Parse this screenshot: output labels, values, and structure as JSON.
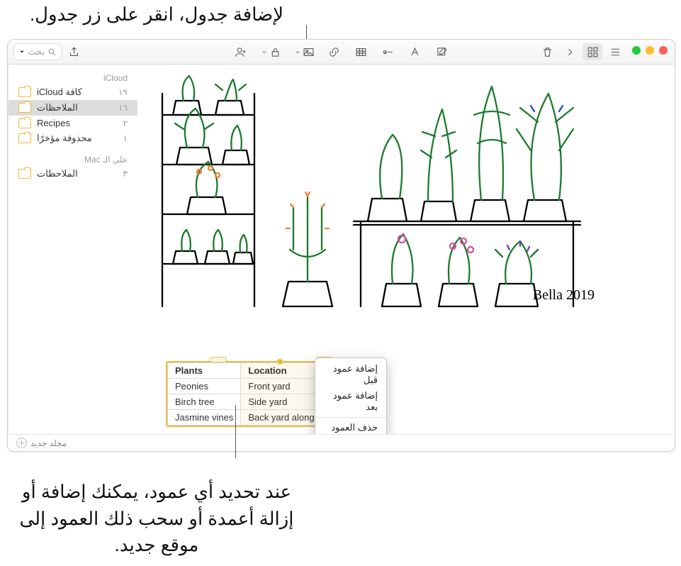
{
  "callouts": {
    "top": "لإضافة جدول، انقر على زر جدول.",
    "bottom": "عند تحديد أي عمود، يمكنك إضافة أو إزالة أعمدة أو سحب ذلك العمود إلى موقع جديد."
  },
  "toolbar": {
    "search_placeholder": "بحث"
  },
  "sidebar": {
    "section1_title": "iCloud",
    "section2_title": "على الـ Mac",
    "items1": [
      {
        "label": "كافة iCloud",
        "count": "١٩"
      },
      {
        "label": "الملاحظات",
        "count": "١٦",
        "selected": true
      },
      {
        "label": "Recipes",
        "count": "٢"
      },
      {
        "label": "محذوفة مؤخرًا",
        "count": "١"
      }
    ],
    "items2": [
      {
        "label": "الملاحظات",
        "count": "٣"
      }
    ]
  },
  "table": {
    "headers": [
      "Plants",
      "Location"
    ],
    "rows": [
      [
        "Peonies",
        "Front yard"
      ],
      [
        "Birch tree",
        "Side yard"
      ],
      [
        "Jasmine vines",
        "Back yard along fence"
      ]
    ]
  },
  "context_menu": {
    "add_before": "إضافة عمود قبل",
    "add_after": "إضافة عمود بعد",
    "delete": "حذف العمود"
  },
  "footer": {
    "new_folder": "مجلد جديد"
  },
  "illustration_signature": "Bella 2019"
}
